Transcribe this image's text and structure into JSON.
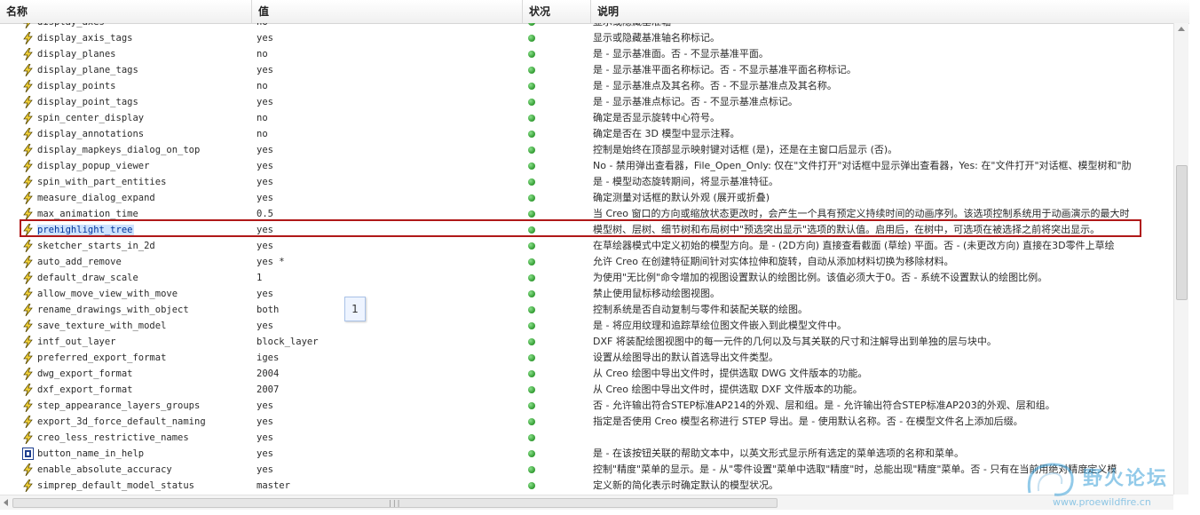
{
  "header": {
    "col_name": "名称",
    "col_value": "值",
    "col_status": "状况",
    "col_desc": "说明"
  },
  "top_partial": {
    "name": "display_axes",
    "value": "no",
    "desc": "显示或隐藏基准轴"
  },
  "rows": [
    {
      "name": "display_axis_tags",
      "value": "yes",
      "desc": "显示或隐藏基准轴名称标记。",
      "icon": "lightning-icon"
    },
    {
      "name": "display_planes",
      "value": "no",
      "desc": "是 - 显示基准面。否 - 不显示基准平面。",
      "icon": "lightning-icon"
    },
    {
      "name": "display_plane_tags",
      "value": "yes",
      "desc": "是 - 显示基准平面名称标记。否 - 不显示基准平面名称标记。",
      "icon": "lightning-icon"
    },
    {
      "name": "display_points",
      "value": "no",
      "desc": "是 - 显示基准点及其名称。否 - 不显示基准点及其名称。",
      "icon": "lightning-icon"
    },
    {
      "name": "display_point_tags",
      "value": "yes",
      "desc": "是 - 显示基准点标记。否 - 不显示基准点标记。",
      "icon": "lightning-icon"
    },
    {
      "name": "spin_center_display",
      "value": "no",
      "desc": "确定是否显示旋转中心符号。",
      "icon": "lightning-icon"
    },
    {
      "name": "display_annotations",
      "value": "no",
      "desc": "确定是否在 3D 模型中显示注释。",
      "icon": "lightning-icon"
    },
    {
      "name": "display_mapkeys_dialog_on_top",
      "value": "yes",
      "desc": "控制是始终在顶部显示映射键对话框 (是)，还是在主窗口后显示 (否)。",
      "icon": "lightning-icon"
    },
    {
      "name": "display_popup_viewer",
      "value": "yes",
      "desc": "No - 禁用弹出查看器，File_Open_Only: 仅在\"文件打开\"对话框中显示弹出查看器，Yes: 在\"文件打开\"对话框、模型树和\"肋",
      "icon": "lightning-icon"
    },
    {
      "name": "spin_with_part_entities",
      "value": "yes",
      "desc": "是 - 模型动态旋转期间，将显示基准特征。",
      "icon": "lightning-icon"
    },
    {
      "name": "measure_dialog_expand",
      "value": "yes",
      "desc": "确定测量对话框的默认外观 (展开或折叠)",
      "icon": "lightning-icon"
    },
    {
      "name": "max_animation_time",
      "value": "0.5",
      "desc": "当 Creo 窗口的方向或缩放状态更改时，会产生一个具有预定义持续时间的动画序列。该选项控制系统用于动画演示的最大时",
      "icon": "lightning-icon"
    },
    {
      "name": "prehighlight_tree",
      "value": "yes",
      "desc": "模型树、层树、细节树和布局树中\"预选突出显示\"选项的默认值。启用后，在树中，可选项在被选择之前将突出显示。",
      "icon": "lightning-icon",
      "selected": true
    },
    {
      "name": "sketcher_starts_in_2d",
      "value": "yes",
      "desc": "在草绘器模式中定义初始的模型方向。是 - (2D方向) 直接查看截面 (草绘) 平面。否 - (未更改方向) 直接在3D零件上草绘",
      "icon": "lightning-icon"
    },
    {
      "name": "auto_add_remove",
      "value": "yes *",
      "desc": "允许 Creo 在创建特征期间针对实体拉伸和旋转，自动从添加材料切换为移除材料。",
      "icon": "lightning-icon"
    },
    {
      "name": "default_draw_scale",
      "value": "1",
      "desc": "为使用\"无比例\"命令增加的视图设置默认的绘图比例。该值必须大于0。否 - 系统不设置默认的绘图比例。",
      "icon": "lightning-icon"
    },
    {
      "name": "allow_move_view_with_move",
      "value": "yes",
      "desc": "禁止使用鼠标移动绘图视图。",
      "icon": "lightning-icon"
    },
    {
      "name": "rename_drawings_with_object",
      "value": "both",
      "desc": "控制系统是否自动复制与零件和装配关联的绘图。",
      "icon": "lightning-icon"
    },
    {
      "name": "save_texture_with_model",
      "value": "yes",
      "desc": "是 - 将应用纹理和追踪草绘位图文件嵌入到此模型文件中。",
      "icon": "lightning-icon"
    },
    {
      "name": "intf_out_layer",
      "value": "block_layer",
      "desc": "DXF 将装配绘图视图中的每一元件的几何以及与其关联的尺寸和注解导出到单独的层与块中。",
      "icon": "lightning-icon"
    },
    {
      "name": "preferred_export_format",
      "value": "iges",
      "desc": "设置从绘图导出的默认首选导出文件类型。",
      "icon": "lightning-icon"
    },
    {
      "name": "dwg_export_format",
      "value": "2004",
      "desc": "从 Creo 绘图中导出文件时，提供选取 DWG 文件版本的功能。",
      "icon": "lightning-icon"
    },
    {
      "name": "dxf_export_format",
      "value": "2007",
      "desc": "从 Creo 绘图中导出文件时，提供选取 DXF 文件版本的功能。",
      "icon": "lightning-icon"
    },
    {
      "name": "step_appearance_layers_groups",
      "value": "yes",
      "desc": "否 - 允许输出符合STEP标准AP214的外观、层和组。是 - 允许输出符合STEP标准AP203的外观、层和组。",
      "icon": "lightning-icon"
    },
    {
      "name": "export_3d_force_default_naming",
      "value": "yes",
      "desc": "指定是否使用 Creo 模型名称进行 STEP 导出。是 - 使用默认名称。否 - 在模型文件名上添加后缀。",
      "icon": "lightning-icon"
    },
    {
      "name": "creo_less_restrictive_names",
      "value": "yes",
      "desc": "",
      "icon": "lightning-icon"
    },
    {
      "name": "button_name_in_help",
      "value": "yes",
      "desc": "是 - 在该按钮关联的帮助文本中，以英文形式显示所有选定的菜单选项的名称和菜单。",
      "icon": "help-box-icon"
    },
    {
      "name": "enable_absolute_accuracy",
      "value": "yes",
      "desc": "控制\"精度\"菜单的显示。是 - 从\"零件设置\"菜单中选取\"精度\"时，总能出现\"精度\"菜单。否 - 只有在当前用绝对精度定义模",
      "icon": "lightning-icon"
    },
    {
      "name": "simprep_default_model_status",
      "value": "master",
      "desc": "定义新的简化表示时确定默认的模型状况。",
      "icon": "lightning-icon"
    }
  ],
  "callout_label": "1",
  "watermark": {
    "title": "野火论坛",
    "url": "www.proewildfire.cn"
  },
  "colors": {
    "highlight_border": "#b01818",
    "status_dot": "#2f9a2f",
    "selection": "#cde3ff"
  }
}
